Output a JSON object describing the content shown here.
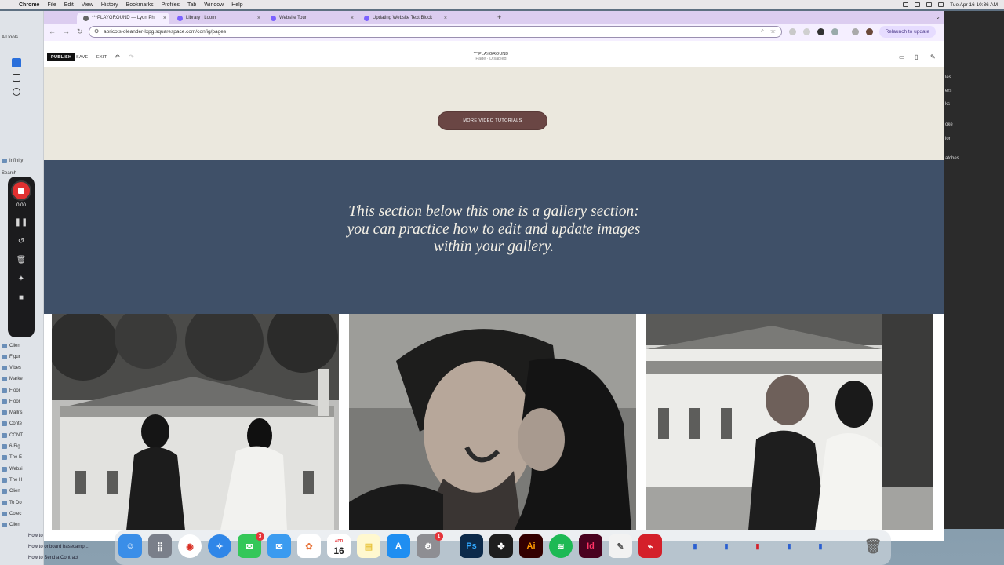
{
  "menubar": {
    "apple": "",
    "app": "Chrome",
    "items": [
      "File",
      "Edit",
      "View",
      "History",
      "Bookmarks",
      "Profiles",
      "Tab",
      "Window",
      "Help"
    ],
    "clock": "Tue Apr 16  10:36 AM"
  },
  "chrome": {
    "tabs": [
      {
        "label": "***PLAYGROUND — Lyon Ph",
        "active": true
      },
      {
        "label": "Library | Loom",
        "active": false
      },
      {
        "label": "Website Tour",
        "active": false
      },
      {
        "label": "Updating Website Text Block",
        "active": false
      }
    ],
    "sidebar_label": "All tools",
    "url": "apricots-oleander-lxpg.squarespace.com/config/pages",
    "relaunch_label": "Relaunch to update"
  },
  "editor": {
    "publish": "PUBLISH",
    "save": "SAVE",
    "exit": "EXIT",
    "page_title": "***PLAYGROUND",
    "page_subtitle": "Page · Disabled"
  },
  "page": {
    "more_button": "MORE VIDEO TUTORIALS",
    "headline": "This section below this one is a gallery section: you can practice how to edit and update images within your gallery."
  },
  "loom": {
    "timer": "0:00"
  },
  "finder": {
    "items": [
      "Infinity",
      "Search",
      "Clien",
      "Figur",
      "Vibes",
      "Marke",
      "Floor",
      "Floor",
      "Malli's",
      "Conte",
      "CONT",
      "6-Fig",
      "The E",
      "Websi",
      "The H",
      "Clien",
      "To Do",
      "Colec",
      "Clien",
      "Clien"
    ],
    "bottom": [
      "How to Handoff",
      "How to onboard basecamp ...",
      "How to Send a Contract"
    ]
  },
  "bg_window": {
    "items": [
      "les",
      "ers",
      "ks",
      "oke",
      "lor",
      "atches"
    ]
  },
  "dock": {
    "calendar_month": "APR",
    "calendar_day": "16",
    "messages_badge": "3",
    "appstore_badge": "1",
    "apps": [
      "Finder",
      "Launchpad",
      "Chrome",
      "Safari",
      "Messages",
      "Mail",
      "Photos",
      "Calendar",
      "Notes",
      "App Store",
      "System Settings",
      "Photoshop",
      "Figma",
      "Illustrator",
      "Spotify",
      "InDesign",
      "TextEdit",
      "Acrobat",
      "Trash"
    ]
  },
  "colors": {
    "section1_bg": "#ebe8de",
    "section2_bg": "#3f5068",
    "button_bg": "#6a4644",
    "headline_color": "#f4f0e6",
    "tabbar": "#dccdf0"
  }
}
